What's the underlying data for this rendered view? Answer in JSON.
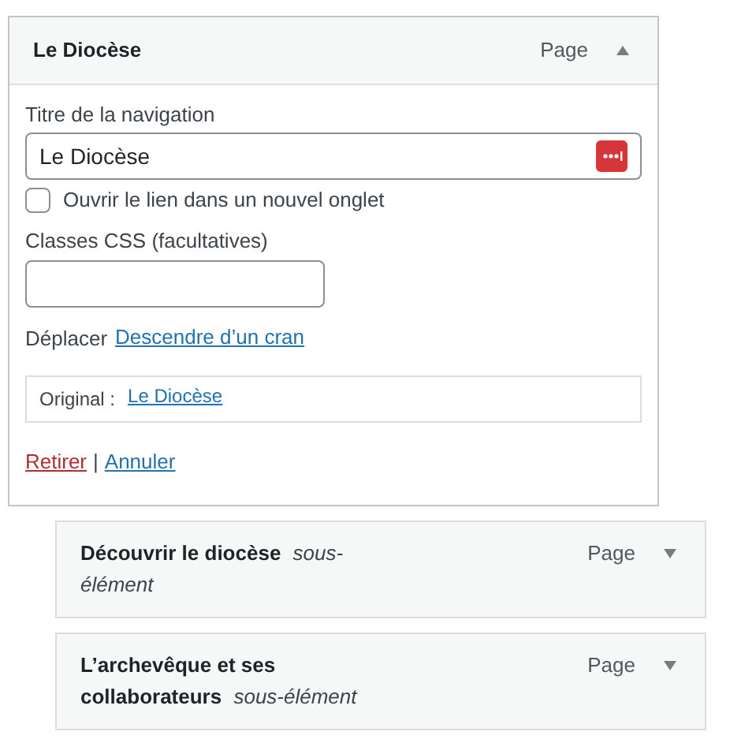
{
  "items": [
    {
      "title": "Le Diocèse",
      "type": "Page",
      "expanded": true,
      "child": false,
      "settings": {
        "nav_label": "Titre de la navigation",
        "nav_value": "Le Diocèse",
        "new_tab": {
          "label": "Ouvrir le lien dans un nouvel onglet",
          "checked": false
        },
        "css_label": "Classes CSS (facultatives)",
        "move_label": "Déplacer",
        "move_link": "Descendre d’un cran",
        "original_label": "Original :",
        "original_link": "Le Diocèse",
        "remove": "Retirer",
        "separator": "|",
        "cancel": "Annuler"
      }
    },
    {
      "title": "Découvrir le diocèse",
      "note": "sous-élément",
      "type": "Page",
      "expanded": false,
      "child": true
    },
    {
      "title": "L’archevêque et ses collaborateurs",
      "note": "sous-élément",
      "type": "Page",
      "expanded": false,
      "child": true
    }
  ]
}
